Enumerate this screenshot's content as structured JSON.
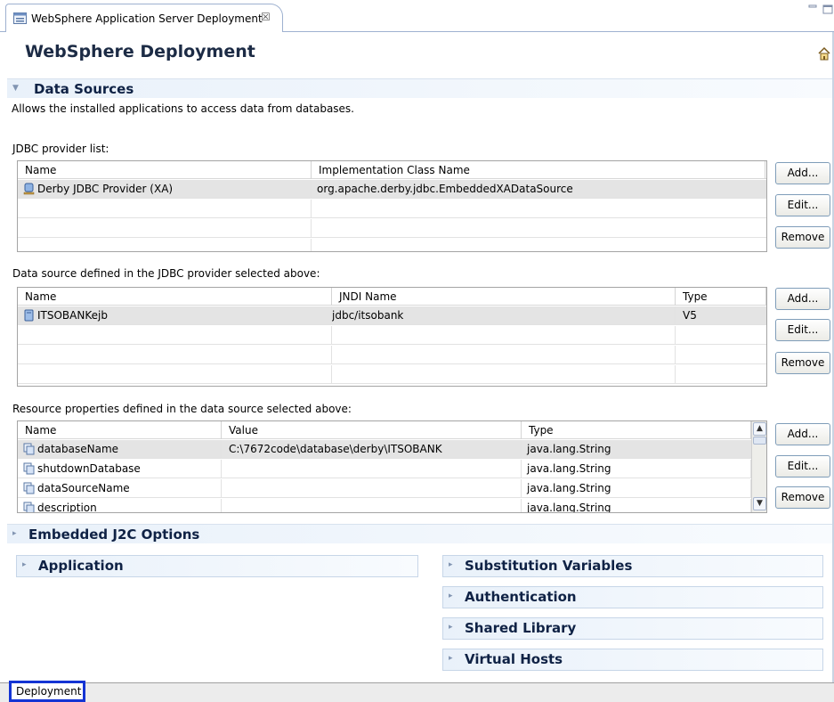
{
  "editor_tab": {
    "title": "WebSphere Application Server Deployment",
    "close": "☒"
  },
  "page": {
    "title": "WebSphere Deployment"
  },
  "data_sources": {
    "title": "Data Sources",
    "description": "Allows the installed applications to access data from databases.",
    "jdbc": {
      "label": "JDBC provider list:",
      "columns": [
        "Name",
        "Implementation Class Name"
      ],
      "rows": [
        {
          "name": "Derby JDBC Provider (XA)",
          "impl": "org.apache.derby.jdbc.EmbeddedXADataSource"
        }
      ]
    },
    "datasource": {
      "label": "Data source defined in the JDBC provider selected above:",
      "columns": [
        "Name",
        "JNDI Name",
        "Type"
      ],
      "rows": [
        {
          "name": "ITSOBANKejb",
          "jndi": "jdbc/itsobank",
          "type": "V5"
        }
      ]
    },
    "resources": {
      "label": "Resource properties defined in the data source selected above:",
      "columns": [
        "Name",
        "Value",
        "Type"
      ],
      "rows": [
        {
          "name": "databaseName",
          "value": "C:\\7672code\\database\\derby\\ITSOBANK",
          "type": "java.lang.String"
        },
        {
          "name": "shutdownDatabase",
          "value": "",
          "type": "java.lang.String"
        },
        {
          "name": "dataSourceName",
          "value": "",
          "type": "java.lang.String"
        },
        {
          "name": "description",
          "value": "",
          "type": "java.lang.String"
        }
      ]
    },
    "buttons": {
      "add": "Add...",
      "edit": "Edit...",
      "remove": "Remove"
    }
  },
  "sections": {
    "embedded_j2c": "Embedded J2C Options",
    "application": "Application",
    "substitution_variables": "Substitution Variables",
    "authentication": "Authentication",
    "shared_library": "Shared Library",
    "virtual_hosts": "Virtual Hosts"
  },
  "bottom_tab": "Deployment",
  "icons": {
    "tab": "server-config-icon",
    "home": "home-icon",
    "jdbc_row": "database-driver-icon",
    "datasource_row": "datasource-icon",
    "property_row": "property-icon"
  },
  "colors": {
    "section_text": "#0f2245",
    "bottom_tab_highlight": "#1434d4",
    "selected_row": "#e4e4e4"
  }
}
